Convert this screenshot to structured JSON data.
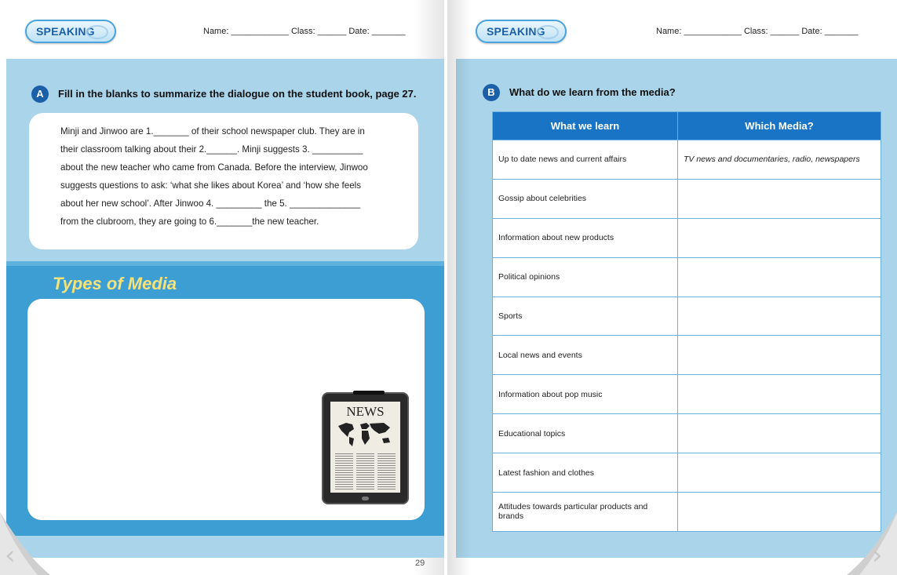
{
  "header": {
    "badge": "SPEAKING",
    "name_label": "Name:",
    "class_label": "Class:",
    "date_label": "Date:"
  },
  "left_page": {
    "section_a": {
      "letter": "A",
      "question": "Fill in the blanks to summarize the dialogue on the student book, page 27.",
      "lines": [
        " Minji and Jinwoo are 1._______ of their school newspaper club. They are in",
        "their classroom talking about their 2.______. Minji suggests 3. __________",
        "about the new teacher who came from Canada. Before the interview, Jinwoo",
        "suggests questions to ask: ‘what she likes about Korea’ and ‘how she feels",
        "about her new school’. After Jinwoo 4. _________ the 5. ______________",
        "from the clubroom, they are going to 6._______the new teacher."
      ]
    },
    "media_title": "Types of Media",
    "tablet_headline": "NEWS",
    "page_number": "29"
  },
  "right_page": {
    "section_b": {
      "letter": "B",
      "question": "What do we learn from the media?"
    },
    "table": {
      "headers": [
        "What we learn",
        "Which Media?"
      ],
      "rows": [
        [
          "Up to date news and current affairs",
          "TV news and documentaries, radio, newspapers"
        ],
        [
          "Gossip about celebrities",
          ""
        ],
        [
          "Information about new products",
          ""
        ],
        [
          "Political opinions",
          ""
        ],
        [
          "Sports",
          ""
        ],
        [
          "Local news and events",
          ""
        ],
        [
          "Information about pop music",
          ""
        ],
        [
          "Educational topics",
          ""
        ],
        [
          "Latest fashion and clothes",
          ""
        ],
        [
          "Attitudes towards particular products and brands",
          ""
        ]
      ]
    }
  },
  "navigation": {
    "prev_arrow": "‹",
    "next_arrow": "›"
  },
  "colors": {
    "band_light": "#a9d4ea",
    "band_dark": "#3d9ed4",
    "header_blue": "#1a74c5",
    "title_yellow": "#f5e37a"
  }
}
